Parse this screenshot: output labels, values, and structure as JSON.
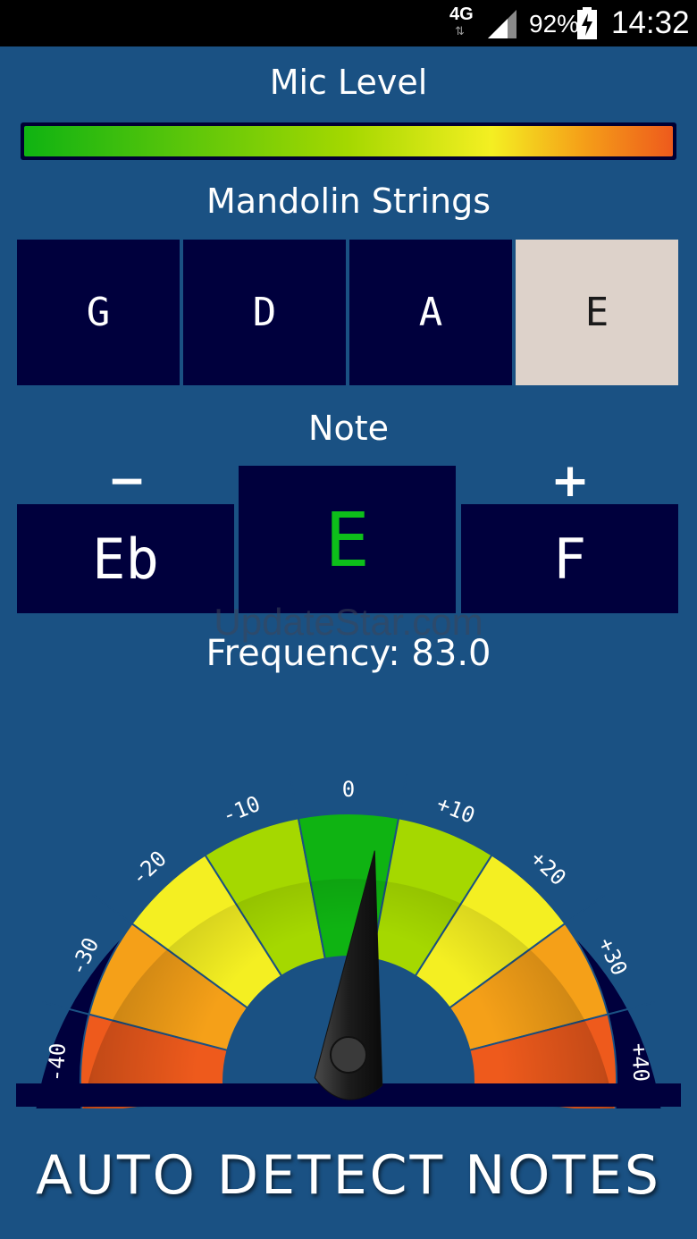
{
  "status_bar": {
    "network": "4G",
    "battery_percent": "92%",
    "time": "14:32"
  },
  "mic": {
    "title": "Mic Level",
    "level": 1.0
  },
  "strings": {
    "title": "Mandolin Strings",
    "items": [
      "G",
      "D",
      "A",
      "E"
    ],
    "selected": "E"
  },
  "note": {
    "title": "Note",
    "minus_sign": "−",
    "plus_sign": "+",
    "prev": "Eb",
    "current": "E",
    "next": "F",
    "current_color": "#0dbf1a"
  },
  "frequency_text": "Frequency: 83.0",
  "watermark": "UpdateStar.com",
  "gauge": {
    "ticks": [
      "-40",
      "-30",
      "-20",
      "-10",
      "0",
      "+10",
      "+20",
      "+30",
      "+40"
    ],
    "needle_cents": 3,
    "zone_colors": [
      "#ee5a1c",
      "#f5a018",
      "#f4ef22",
      "#a5d800",
      "#0fb312",
      "#a5d800",
      "#f4ef22",
      "#f5a018",
      "#ee5a1c"
    ]
  },
  "auto_detect_label": "AUTO DETECT NOTES"
}
